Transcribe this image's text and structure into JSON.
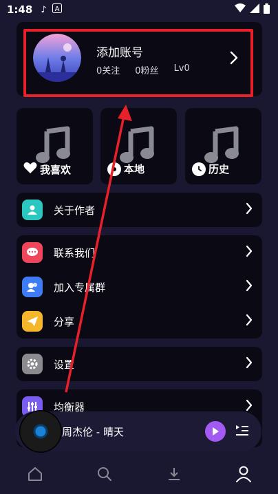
{
  "status_bar": {
    "time": "1:48"
  },
  "profile": {
    "name": "添加账号",
    "follows": "0关注",
    "fans": "0粉丝",
    "level": "Lv0"
  },
  "tiles": [
    {
      "label": "我喜欢",
      "icon": "heart-icon"
    },
    {
      "label": "本地",
      "icon": "local-music-icon"
    },
    {
      "label": "历史",
      "icon": "clock-icon"
    }
  ],
  "menu": {
    "about": "关于作者",
    "contact": "联系我们",
    "join_group": "加入专属群",
    "share": "分享",
    "settings": "设置",
    "equalizer": "均衡器"
  },
  "player": {
    "track": "周杰伦  -  晴天"
  },
  "colors": {
    "background": "#1a1730",
    "card": "#0b0a14",
    "highlight": "#e8202a",
    "accent": "#a25af2"
  }
}
